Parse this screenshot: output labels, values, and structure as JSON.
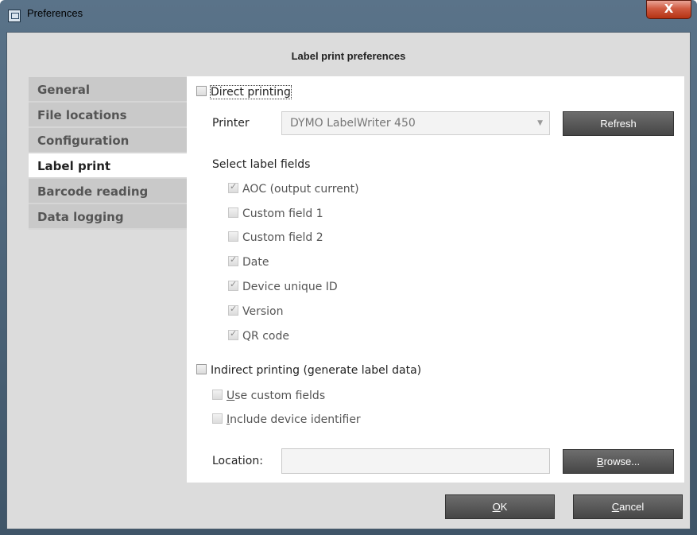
{
  "window": {
    "title": "Preferences",
    "close_glyph": "X"
  },
  "header": {
    "title": "Label print preferences"
  },
  "sidebar": {
    "items": [
      {
        "label": "General",
        "active": false
      },
      {
        "label": "File locations",
        "active": false
      },
      {
        "label": "Configuration",
        "active": false
      },
      {
        "label": "Label print",
        "active": true
      },
      {
        "label": "Barcode reading",
        "active": false
      },
      {
        "label": "Data logging",
        "active": false
      }
    ]
  },
  "direct": {
    "label": "Direct printing",
    "checked": false
  },
  "printer": {
    "label": "Printer",
    "value": "DYMO LabelWriter 450",
    "refresh_label": "Refresh"
  },
  "fields": {
    "heading": "Select label fields",
    "items": [
      {
        "label": "AOC (output current)",
        "checked": true
      },
      {
        "label": "Custom field 1",
        "checked": false
      },
      {
        "label": "Custom field 2",
        "checked": false
      },
      {
        "label": "Date",
        "checked": true
      },
      {
        "label": "Device unique ID",
        "checked": true
      },
      {
        "label": "Version",
        "checked": true
      },
      {
        "label": "QR code",
        "checked": true
      }
    ]
  },
  "indirect": {
    "label": "Indirect printing (generate label data)",
    "checked": false,
    "use_custom_key": "U",
    "use_custom_rest": "se custom fields",
    "include_key": "I",
    "include_rest": "nclude device identifier"
  },
  "location": {
    "label": "Location:",
    "value": "",
    "browse_key": "B",
    "browse_rest": "rowse..."
  },
  "footer": {
    "ok_key": "O",
    "ok_rest": "K",
    "cancel_key": "C",
    "cancel_rest": "ancel"
  },
  "colors": {
    "title_bar": "#4e657a",
    "client_bg": "#dcdcdc",
    "button_bg": "#5a5a5a",
    "close_red": "#c8472b"
  }
}
